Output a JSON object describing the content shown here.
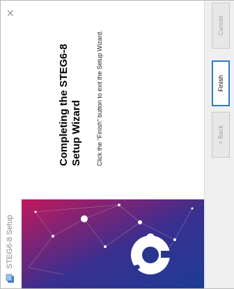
{
  "window": {
    "title": "STEG6-8 Setup",
    "close_glyph": "✕",
    "icon": "installer-icon"
  },
  "page": {
    "heading_line1": "Completing the STEG6-8",
    "heading_line2": "Setup Wizard",
    "body": "Click the \"Finish\" button to exit the Setup Wizard."
  },
  "buttons": {
    "back": "< Back",
    "finish": "Finish",
    "cancel": "Cancel"
  },
  "colors": {
    "banner_start": "#1c3c95",
    "banner_end": "#c2185b",
    "focus_border": "#2e78d0"
  }
}
